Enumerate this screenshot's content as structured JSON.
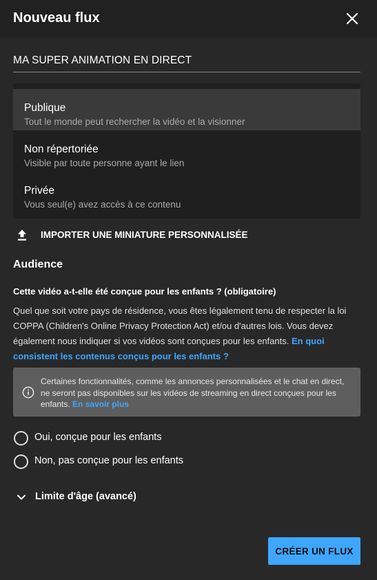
{
  "dialog": {
    "title": "Nouveau flux",
    "close_icon": "close-icon"
  },
  "stream": {
    "title": "MA SUPER ANIMATION EN DIRECT"
  },
  "visibility": {
    "selected": "Publique",
    "options": [
      {
        "label": "Publique",
        "description": "Tout le monde peut rechercher la vidéo et la visionner"
      },
      {
        "label": "Non répertoriée",
        "description": "Visible par toute personne ayant le lien"
      },
      {
        "label": "Privée",
        "description": "Vous seul(e) avez accès à ce contenu"
      }
    ]
  },
  "thumbnail": {
    "upload_label": "IMPORTER UNE MINIATURE PERSONNALISÉE",
    "icon": "upload-icon"
  },
  "audience": {
    "heading": "Audience",
    "question": "Cette vidéo a-t-elle été conçue pour les enfants ? (obligatoire)",
    "explanation": "Quel que soit votre pays de résidence, vous êtes légalement tenu de respecter la loi COPPA (Children's Online Privacy Protection Act) et/ou d'autres lois. Vous devez également nous indiquer si vos vidéos sont conçues pour les enfants.",
    "explanation_link": "En quoi consistent les contenus conçus pour les enfants ?",
    "notice": {
      "icon": "info-icon",
      "text": "Certaines fonctionnalités, comme les annonces personnalisées et le chat en direct, ne seront pas disponibles sur les vidéos de streaming en direct conçues pour les enfants.",
      "link": "En savoir plus"
    },
    "options": [
      {
        "label": "Oui, conçue pour les enfants"
      },
      {
        "label": "Non, pas conçue pour les enfants"
      }
    ]
  },
  "age_restriction": {
    "label": "Limite d'âge (avancé)",
    "icon": "chevron-down-icon"
  },
  "actions": {
    "create_label": "CRÉER UN FLUX"
  },
  "colors": {
    "accent": "#3ea6ff",
    "background": "#282828",
    "header": "#212121"
  }
}
